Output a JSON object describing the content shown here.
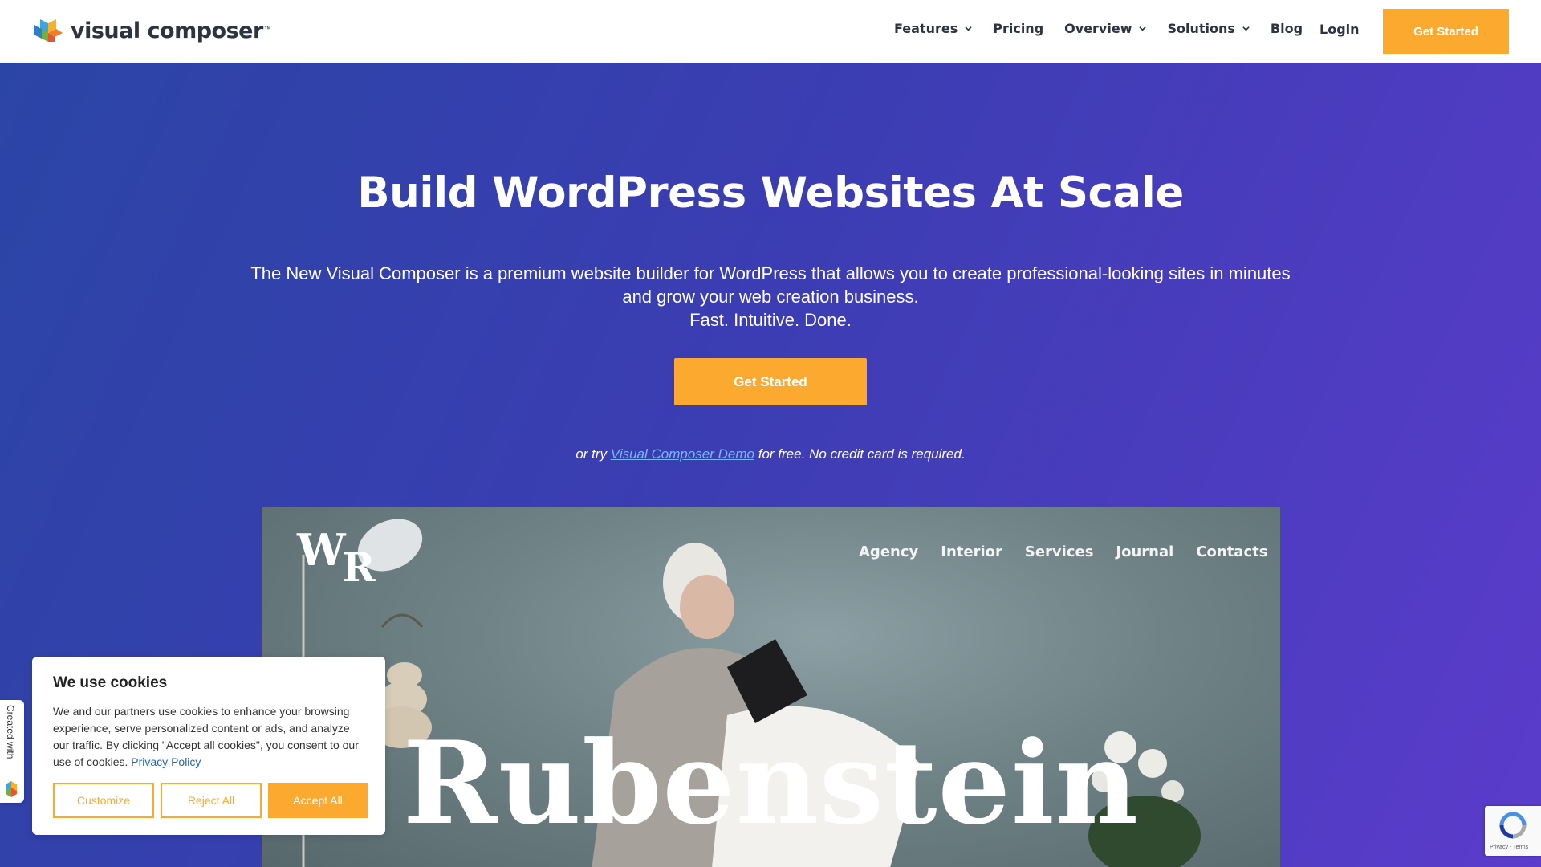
{
  "header": {
    "logo_text": "visual composer",
    "logo_tm": "™",
    "nav": [
      {
        "label": "Features",
        "dropdown": true
      },
      {
        "label": "Pricing",
        "dropdown": false
      },
      {
        "label": "Overview",
        "dropdown": true
      },
      {
        "label": "Solutions",
        "dropdown": true
      },
      {
        "label": "Blog",
        "dropdown": false
      }
    ],
    "login_label": "Login",
    "cta_label": "Get Started"
  },
  "hero": {
    "title": "Build WordPress Websites At Scale",
    "description": "The New Visual Composer is a premium website builder for WordPress that allows you to create professional-looking sites in minutes and grow your web creation business.",
    "tagline": "Fast. Intuitive. Done.",
    "cta_label": "Get Started",
    "note_prefix": "or try",
    "note_link": "Visual Composer Demo",
    "note_suffix": "for free. No credit card is required."
  },
  "preview": {
    "logo_w": "W",
    "logo_r": "R",
    "nav": [
      "Agency",
      "Interior",
      "Services",
      "Journal",
      "Contacts"
    ],
    "brand_word": "Rubenstein"
  },
  "cookie": {
    "title": "We use cookies",
    "body": "We and our partners use cookies to enhance your browsing experience, serve personalized content or ads, and analyze our traffic. By clicking \"Accept all cookies\", you consent to our use of cookies.",
    "policy_link": "Privacy Policy",
    "customize_label": "Customize",
    "reject_label": "Reject All",
    "accept_label": "Accept All"
  },
  "side_tab": {
    "label": "Created with"
  },
  "recaptcha": {
    "text": "Privacy - Terms"
  },
  "colors": {
    "accent": "#fbaa2f",
    "hero_start": "#2b45a6",
    "hero_end": "#5b3ccb",
    "text_dark": "#2b3440",
    "link": "#7ab6ff"
  },
  "icons": {
    "logo_mark": "cube-logo-icon",
    "dropdown": "chevron-down-icon",
    "recaptcha": "recaptcha-icon"
  }
}
